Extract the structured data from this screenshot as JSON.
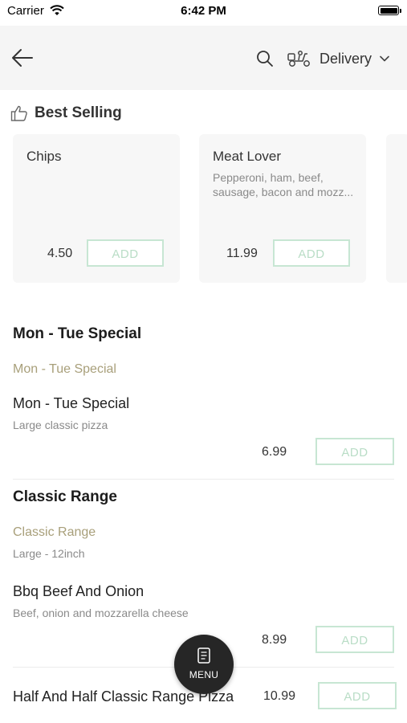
{
  "status_bar": {
    "carrier": "Carrier",
    "time": "6:42 PM"
  },
  "header": {
    "delivery_label": "Delivery"
  },
  "best_selling": {
    "title": "Best Selling",
    "items": [
      {
        "name": "Chips",
        "description": "",
        "price": "4.50",
        "add_label": "ADD"
      },
      {
        "name": "Meat Lover",
        "description": "Pepperoni, ham, beef, sausage, bacon and mozz...",
        "price": "11.99",
        "add_label": "ADD"
      }
    ]
  },
  "sections": [
    {
      "title": "Mon - Tue Special",
      "subcategory": "Mon - Tue Special",
      "items": [
        {
          "name": "Mon - Tue Special",
          "description": "Large classic pizza",
          "price": "6.99",
          "add_label": "ADD"
        }
      ]
    },
    {
      "title": "Classic Range",
      "subcategory": "Classic Range",
      "subcategory_note": "Large - 12inch",
      "items": [
        {
          "name": "Bbq Beef And Onion",
          "description": "Beef, onion and mozzarella cheese",
          "price": "8.99",
          "add_label": "ADD"
        },
        {
          "name": "Half And Half Classic Range Pizza",
          "price": "10.99",
          "add_label": "ADD"
        }
      ]
    }
  ],
  "menu_button": {
    "label": "MENU"
  },
  "colors": {
    "accent_green": "#c7e6d3",
    "subcategory_gold": "#a89f7a",
    "fab_dark": "#262626"
  },
  "icons": [
    "wifi-icon",
    "battery-icon",
    "back-arrow-icon",
    "search-icon",
    "delivery-scooter-icon",
    "chevron-down-icon",
    "thumbs-up-icon",
    "menu-book-icon"
  ]
}
